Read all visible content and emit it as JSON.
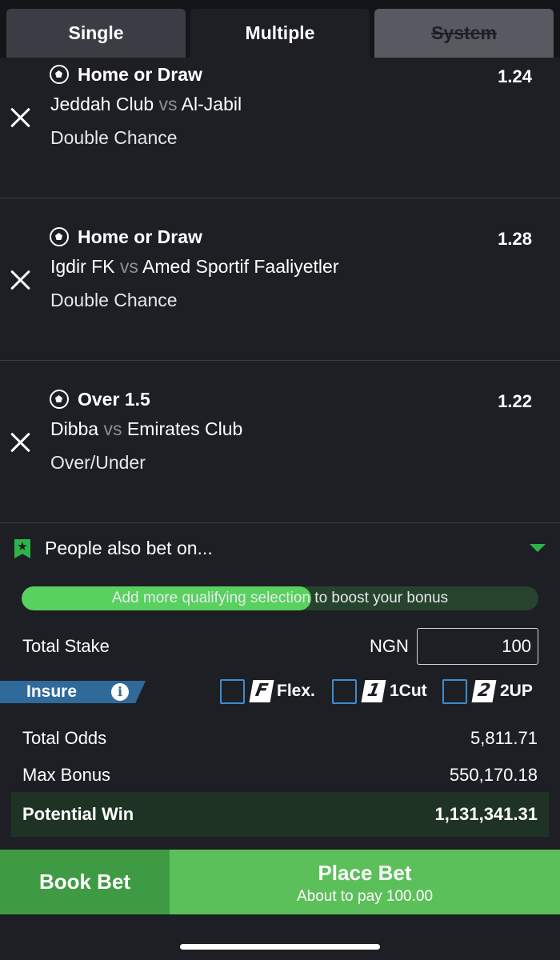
{
  "tabs": {
    "single": "Single",
    "multiple": "Multiple",
    "system": "System"
  },
  "bets": [
    {
      "pick": "Home or Draw",
      "odds": "1.24",
      "home": "Jeddah Club",
      "vs": "vs",
      "away": "Al-Jabil",
      "market": "Double Chance"
    },
    {
      "pick": "Home or Draw",
      "odds": "1.28",
      "home": "Igdir FK",
      "vs": "vs",
      "away": "Amed Sportif Faaliyetler",
      "market": "Double Chance"
    },
    {
      "pick": "Over 1.5",
      "odds": "1.22",
      "home": "Dibba",
      "vs": "vs",
      "away": "Emirates Club",
      "market": "Over/Under"
    }
  ],
  "also_bet": {
    "label": "People also bet on..."
  },
  "bonus_progress": {
    "text": "Add more qualifying selection to boost your bonus",
    "fraction": 0.56
  },
  "stake": {
    "label": "Total Stake",
    "currency": "NGN",
    "value": "100"
  },
  "insure": {
    "label": "Insure",
    "info": "i"
  },
  "options": [
    {
      "badge": "F",
      "label": "Flex."
    },
    {
      "badge": "1",
      "label": "1Cut"
    },
    {
      "badge": "2",
      "label": "2UP"
    }
  ],
  "summary": {
    "total_odds_label": "Total Odds",
    "total_odds": "5,811.71",
    "max_bonus_label": "Max Bonus",
    "max_bonus": "550,170.18",
    "potential_win_label": "Potential Win",
    "potential_win": "1,131,341.31"
  },
  "actions": {
    "book_bet": "Book Bet",
    "place_bet": "Place Bet",
    "pay_note": "About to pay 100.00"
  },
  "colors": {
    "accent_green": "#58d15e",
    "place_bet": "#5bbf5a",
    "book_bet": "#3f9a44",
    "insure_blue": "#2f6a9a",
    "background": "#1d1f24"
  }
}
